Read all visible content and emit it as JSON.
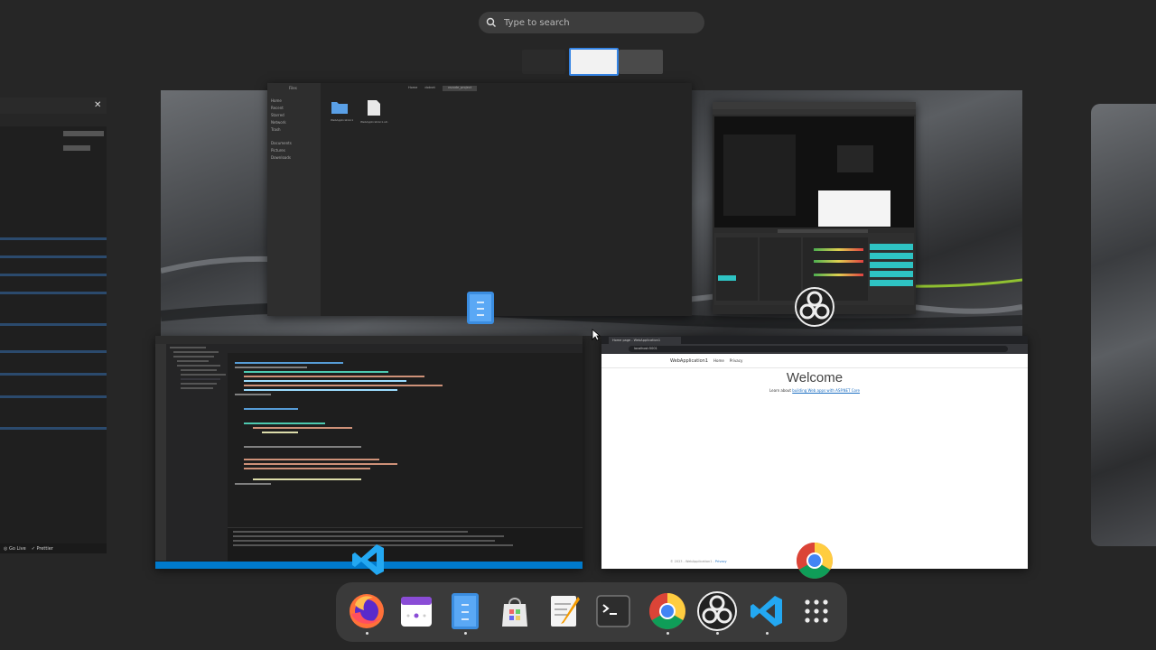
{
  "search": {
    "placeholder": "Type to search"
  },
  "files_window": {
    "sidebar_header": "Files",
    "sidebar_items": [
      "Home",
      "Recent",
      "Starred",
      "Network",
      "Trash",
      "Documents",
      "Pictures",
      "Downloads"
    ],
    "path_segments": [
      "Home",
      "dotnet",
      "vscode_project"
    ],
    "items": [
      "WebApplication1",
      "WebApplication1.sln"
    ]
  },
  "browser_window": {
    "tab_title": "Home page - WebApplication1",
    "url": "localhost:5001",
    "brand": "WebApplication1",
    "nav": [
      "Home",
      "Privacy"
    ],
    "heading": "Welcome",
    "lead_text": "Learn about",
    "lead_link": "building Web apps with ASP.NET Core",
    "footer": "© 2023 - WebApplication1 -",
    "footer_link": "Privacy"
  },
  "vscode_left": {
    "golive": "Go Live",
    "prettier": "Prettier"
  },
  "dock": {
    "apps": [
      "firefox-icon",
      "calendar-icon",
      "files-icon",
      "software-icon",
      "text-editor-icon",
      "terminal-icon",
      "chrome-icon",
      "obs-icon",
      "vscode-icon",
      "app-grid-icon"
    ]
  }
}
